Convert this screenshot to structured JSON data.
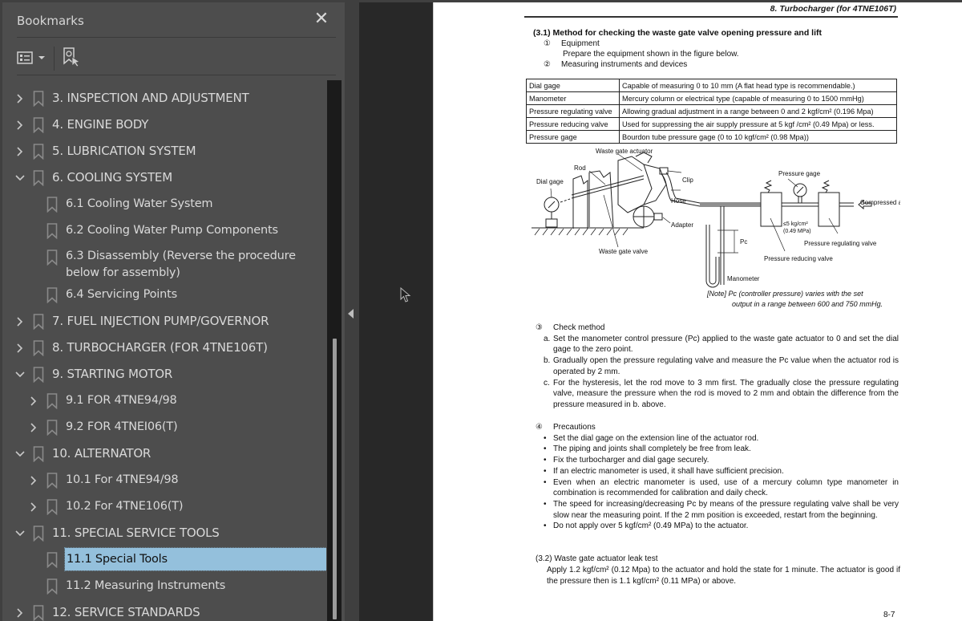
{
  "sidebar": {
    "title": "Bookmarks",
    "close_icon": "close-icon",
    "toolbar": {
      "options_icon": "list-options-icon",
      "find_current_icon": "find-current-bookmark-icon"
    },
    "items": [
      {
        "label": "3.  INSPECTION AND  ADJUSTMENT",
        "level": 0,
        "expander": "collapsed"
      },
      {
        "label": "4. ENGINE BODY",
        "level": 0,
        "expander": "collapsed"
      },
      {
        "label": "5. LUBRICATION SYSTEM",
        "level": 0,
        "expander": "collapsed"
      },
      {
        "label": "6. COOLING SYSTEM",
        "level": 0,
        "expander": "expanded"
      },
      {
        "label": "6.1 Cooling Water System",
        "level": 1,
        "expander": "none"
      },
      {
        "label": "6.2 Cooling Water Pump Components",
        "level": 1,
        "expander": "none"
      },
      {
        "label": "6.3 Disassembly (Reverse the procedure below for assembly)",
        "level": 1,
        "expander": "none"
      },
      {
        "label": "6.4 Servicing Points",
        "level": 1,
        "expander": "none"
      },
      {
        "label": "7. FUEL  INJECTION PUMP/GOVERNOR",
        "level": 0,
        "expander": "collapsed"
      },
      {
        "label": "8. TURBOCHARGER  (FOR  4TNE106T)",
        "level": 0,
        "expander": "collapsed"
      },
      {
        "label": "9.  STARTING MOTOR",
        "level": 0,
        "expander": "expanded"
      },
      {
        "label": "9.1 FOR 4TNE94/98",
        "level": 1,
        "expander": "collapsed"
      },
      {
        "label": "9.2 FOR 4TNEI06(T)",
        "level": 1,
        "expander": "collapsed"
      },
      {
        "label": "10.  ALTERNATOR",
        "level": 0,
        "expander": "expanded"
      },
      {
        "label": "10.1 For 4TNE94/98",
        "level": 1,
        "expander": "collapsed"
      },
      {
        "label": "10.2 For 4TNE106(T)",
        "level": 1,
        "expander": "collapsed"
      },
      {
        "label": "11.  SPECIAL SERVICE TOOLS",
        "level": 0,
        "expander": "expanded"
      },
      {
        "label": "11.1 Special Tools",
        "level": 1,
        "expander": "none",
        "selected": true
      },
      {
        "label": "11.2 Measuring Instruments",
        "level": 1,
        "expander": "none"
      },
      {
        "label": "12.  SERVICE STANDARDS",
        "level": 0,
        "expander": "collapsed"
      }
    ],
    "selected_color": "#94c0dc"
  },
  "document": {
    "running_header": "8.  Turbocharger (for 4TNE106T)",
    "section_31_title": "(3.1) Method for checking the waste gate valve opening pressure and lift",
    "step1": {
      "marker": "①",
      "title": "Equipment",
      "text": "Prepare the equipment shown in the figure below."
    },
    "step2": {
      "marker": "②",
      "title": "Measuring instruments and devices"
    },
    "equipment_table": [
      [
        "Dial gage",
        "Capable of measuring 0 to 10 mm (A flat head type is recommendable.)"
      ],
      [
        "Manometer",
        "Mercury column or electrical type (capable of measuring 0 to 1500 mmHg)"
      ],
      [
        "Pressure regulating valve",
        "Allowing gradual adjustment in a range between 0 and 2 kgf/cm² (0.196 Mpa)"
      ],
      [
        "Pressure reducing valve",
        "Used for suppressing the air supply pressure at 5 kgf /cm² (0.49 Mpa) or less."
      ],
      [
        "Pressure gage",
        "Bourdon tube pressure gage (0 to 10 kgf/cm² (0.98 Mpa))"
      ]
    ],
    "figure_labels": {
      "waste_gate_actuator": "Waste gate actuator",
      "rod": "Rod",
      "dial_gage": "Dial gage",
      "clip": "Clip",
      "hose": "Hose",
      "adapter": "Adapter",
      "waste_gate_valve": "Waste gate valve",
      "pressure_gage": "Pressure gage",
      "compressed_air": "Compressed air",
      "limit_1": "≤5 kg/cm²",
      "limit_2": "(0.49 MPa)",
      "pc": "Pc",
      "pressure_regulating_valve": "Pressure regulating valve",
      "pressure_reducing_valve": "Pressure reducing valve",
      "manometer": "Manometer"
    },
    "note_line1": "[Note]  Pc (controller pressure) varies with the set",
    "note_line2": "output in a range between 600 and 750 mmHg.",
    "step3": {
      "marker": "③",
      "title": "Check method",
      "items": [
        {
          "mark": "a.",
          "text": "Set the manometer control pressure (Pc) applied to the waste gate actuator to 0 and set the dial gage to the zero point."
        },
        {
          "mark": "b.",
          "text": "Gradually open the pressure regulating valve and measure the Pc value when the actuator rod is operated by 2 mm."
        },
        {
          "mark": "c.",
          "text": "For the hysteresis, let the rod move to 3 mm first.  The gradually close the pressure regulating valve, measure the pressure when the rod is moved to 2 mm and obtain the difference from the pressure measured in b. above."
        }
      ]
    },
    "step4": {
      "marker": "④",
      "title": "Precautions",
      "bullets": [
        "Set the dial gage on the extension line of the actuator rod.",
        "The piping and joints shall completely be free from leak.",
        "Fix the turbocharger and dial gage securely.",
        "If an electric manometer is used, it shall have sufficient precision.",
        "Even when an electric manometer is used, use of a mercury column type manometer in combination is recommended for calibration and daily check.",
        "The speed for increasing/decreasing Pc by means of the pressure regulating valve shall be very slow near the measuring point.  If the 2 mm position is exceeded, restart from the beginning.",
        "Do not apply over 5 kgf/cm² (0.49 MPa) to the actuator."
      ]
    },
    "section_32_title": "(3.2) Waste gate actuator leak test",
    "section_32_text": "Apply 1.2 kgf/cm² (0.12 Mpa) to the actuator and hold the state for 1 minute.  The actuator is good if the pressure then is 1.1 kgf/cm² (0.11 MPa) or above.",
    "page_number": "8-7"
  }
}
